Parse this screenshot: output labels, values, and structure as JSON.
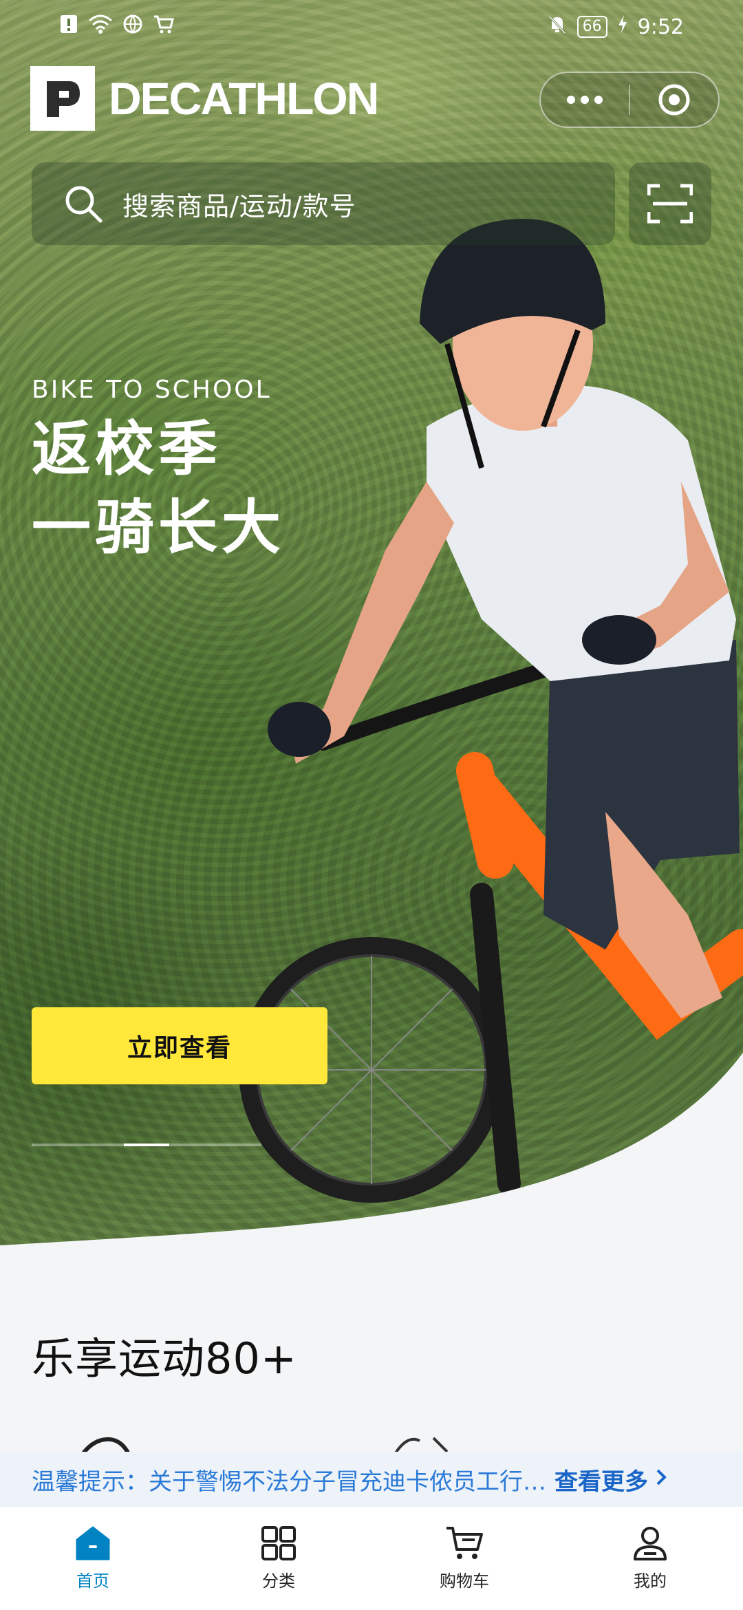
{
  "status_bar": {
    "time": "9:52",
    "battery": "66"
  },
  "header": {
    "brand": "DECATHLON",
    "menu_icon": "more-dots-icon",
    "close_icon": "target-icon"
  },
  "search": {
    "placeholder": "搜索商品/运动/款号",
    "scan_icon": "scan-icon"
  },
  "banner": {
    "tagline": "BIKE TO SCHOOL",
    "title_line1": "返校季",
    "title_line2": "一骑长大",
    "cta": "立即查看",
    "slide_count": 3,
    "active_slide": 2
  },
  "section": {
    "title": "乐享运动80+"
  },
  "notice": {
    "label": "温馨提示：",
    "text": "关于警惕不法分子冒充迪卡侬员工行…",
    "more": "查看更多"
  },
  "tabbar": {
    "items": [
      {
        "label": "首页",
        "icon": "home-icon",
        "active": true
      },
      {
        "label": "分类",
        "icon": "grid-icon",
        "active": false
      },
      {
        "label": "购物车",
        "icon": "cart-icon",
        "active": false
      },
      {
        "label": "我的",
        "icon": "user-icon",
        "active": false
      }
    ]
  },
  "colors": {
    "accent": "#0082c3",
    "cta": "#ffe83a",
    "notice": "#2a7ad8"
  }
}
